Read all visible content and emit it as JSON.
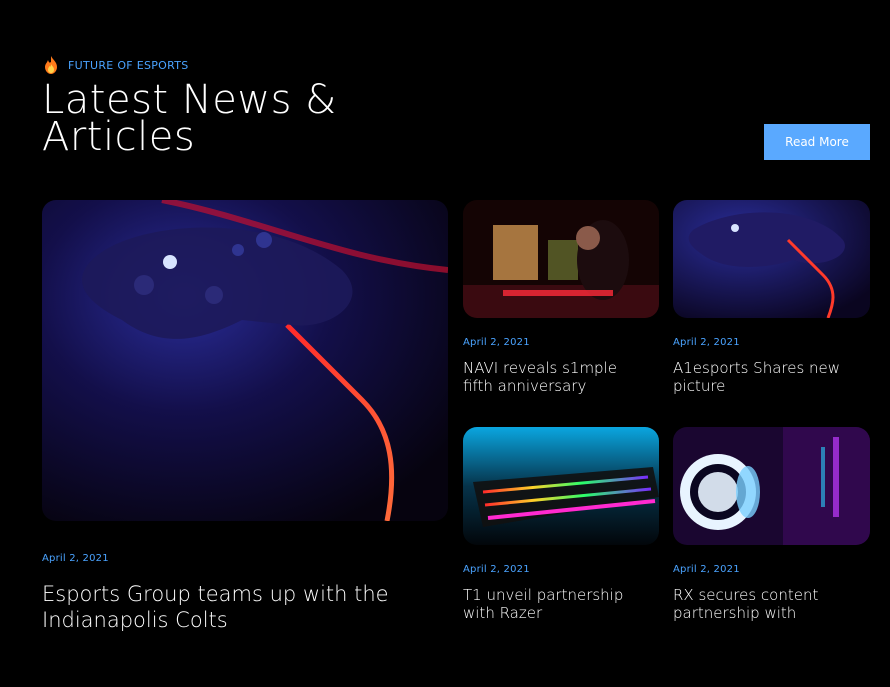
{
  "section": {
    "eyebrow_icon": "fire-icon",
    "eyebrow": "FUTURE OF ESPORTS",
    "title_line1": "Latest News &",
    "title_line2": "Articles",
    "read_more_label": "Read More"
  },
  "colors": {
    "accent": "#5aa9ff",
    "date": "#4aa3ff",
    "background": "#000000"
  },
  "articles": [
    {
      "date": "April 2, 2021",
      "title_line1": "Esports Group teams up with the",
      "title_line2": "Indianapolis Colts",
      "image": "gamepad-red-glow-image"
    },
    {
      "date": "April 2, 2021",
      "title_line1": "NAVI reveals s1mple",
      "title_line2": "fifth anniversary",
      "image": "gamer-at-pc-image"
    },
    {
      "date": "April 2, 2021",
      "title_line1": "A1esports Shares new",
      "title_line2": "picture",
      "image": "gamepad-small-image"
    },
    {
      "date": "April 2, 2021",
      "title_line1": "T1 unveil partnership",
      "title_line2": "with Razer",
      "image": "rgb-keyboard-image"
    },
    {
      "date": "April 2, 2021",
      "title_line1": "RX secures content",
      "title_line2": "partnership with",
      "image": "headset-neon-image"
    }
  ]
}
